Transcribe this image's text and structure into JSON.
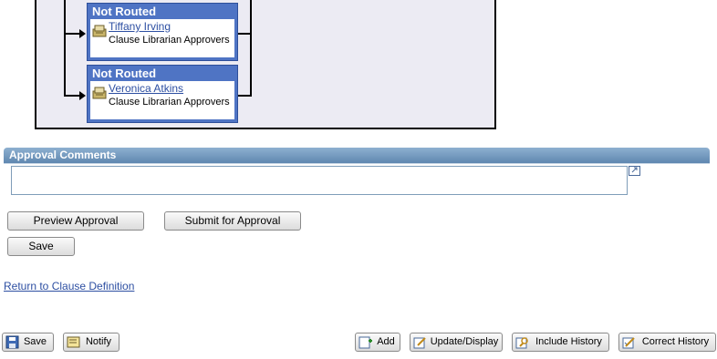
{
  "approval_map": {
    "steps": [
      {
        "status": "Not Routed",
        "approver": "Tiffany Irving",
        "role": "Clause Librarian Approvers"
      },
      {
        "status": "Not Routed",
        "approver": "Veronica Atkins",
        "role": "Clause Librarian Approvers"
      }
    ]
  },
  "comments": {
    "section_title": "Approval Comments",
    "value": ""
  },
  "actions": {
    "preview_label": "Preview Approval",
    "submit_label": "Submit for Approval",
    "save_label": "Save"
  },
  "return_link": "Return to Clause Definition",
  "toolbar": {
    "save": "Save",
    "notify": "Notify",
    "add": "Add",
    "update_display": "Update/Display",
    "include_history": "Include History",
    "correct_history": "Correct History"
  }
}
